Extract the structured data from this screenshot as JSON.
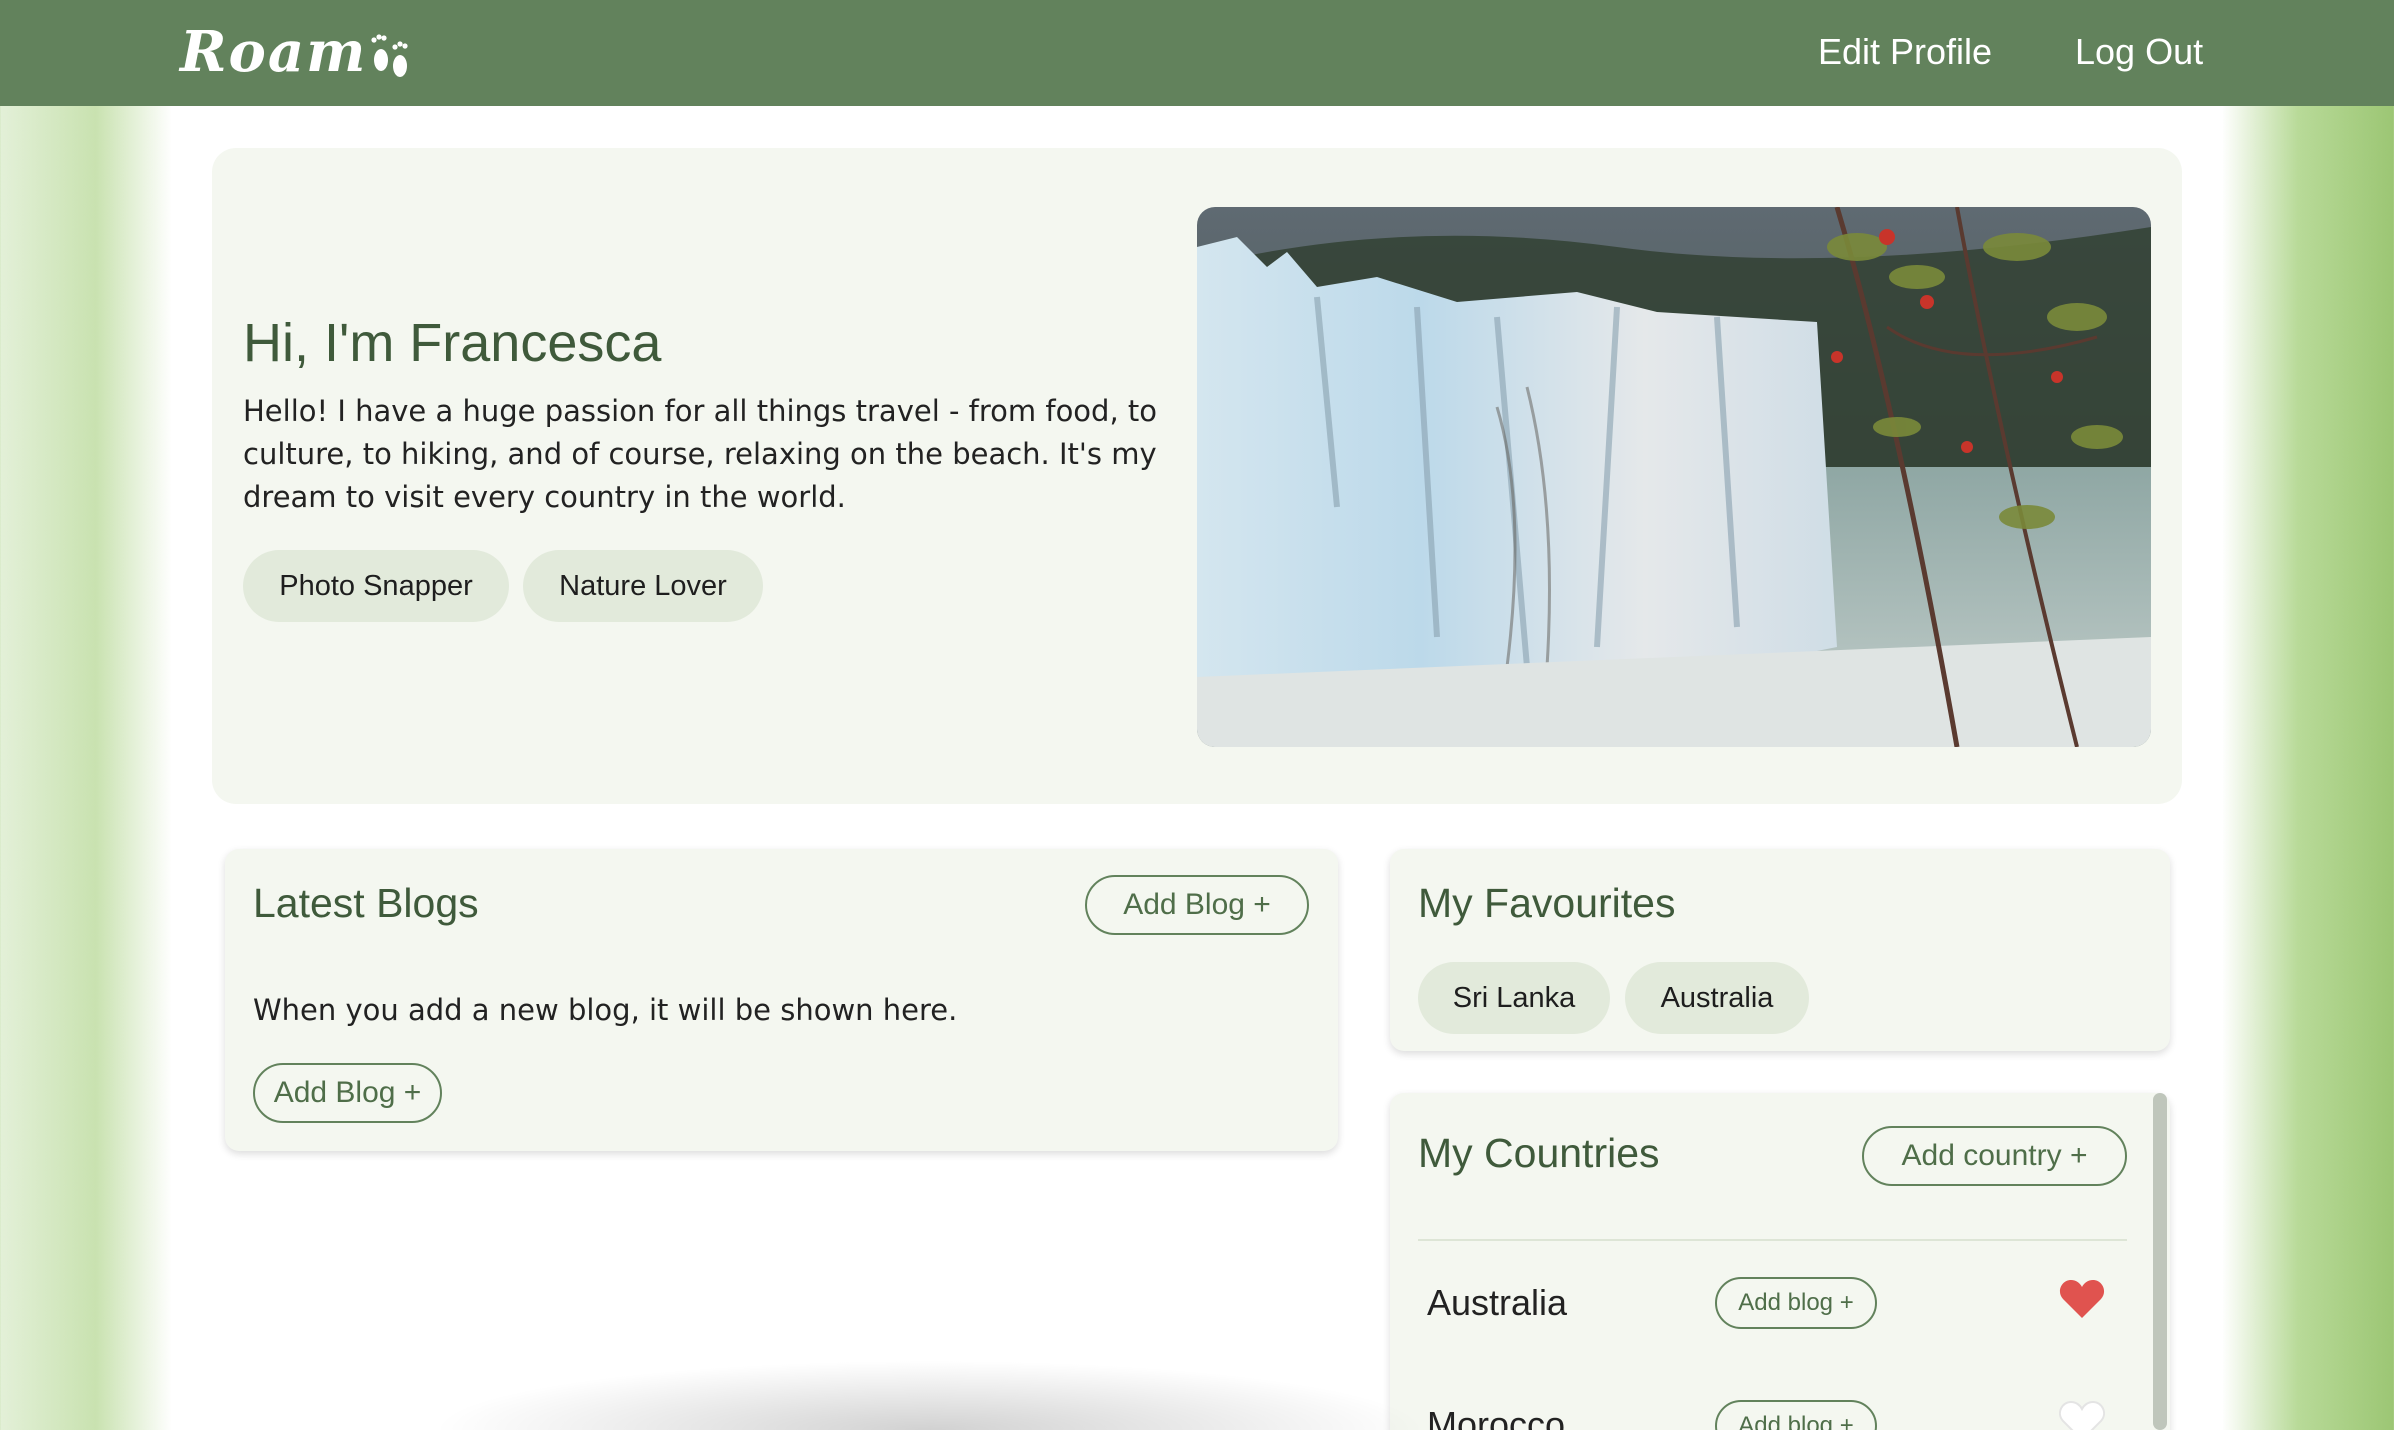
{
  "app": {
    "logo_text": "Roam"
  },
  "nav": {
    "edit_profile": "Edit Profile",
    "log_out": "Log Out"
  },
  "hero": {
    "title": "Hi, I'm Francesca",
    "bio": "Hello! I have a huge passion for all things travel - from food, to culture, to hiking, and of course, relaxing on the beach. It's my dream to visit every country in the world.",
    "tags": [
      "Photo Snapper",
      "Nature Lover"
    ],
    "image_icon": "glacier-photo"
  },
  "latest_blogs": {
    "title": "Latest Blogs",
    "add_button": "Add Blog +",
    "empty_text": "When you add a new blog, it will be shown here.",
    "add_button_bottom": "Add Blog +"
  },
  "favourites": {
    "title": "My Favourites",
    "items": [
      "Sri Lanka",
      "Australia"
    ]
  },
  "countries": {
    "title": "My Countries",
    "add_button": "Add country +",
    "items": [
      {
        "name": "Australia",
        "add_blog": "Add blog +",
        "favourite": true
      },
      {
        "name": "Morocco",
        "add_blog": "Add blog +",
        "favourite": false
      }
    ]
  },
  "colors": {
    "navbar": "#62825c",
    "accent_text": "#3f5a3b",
    "tag_bg": "#e2eadb",
    "card_bg": "#f4f7f0",
    "heart_active": "#e0534f"
  }
}
